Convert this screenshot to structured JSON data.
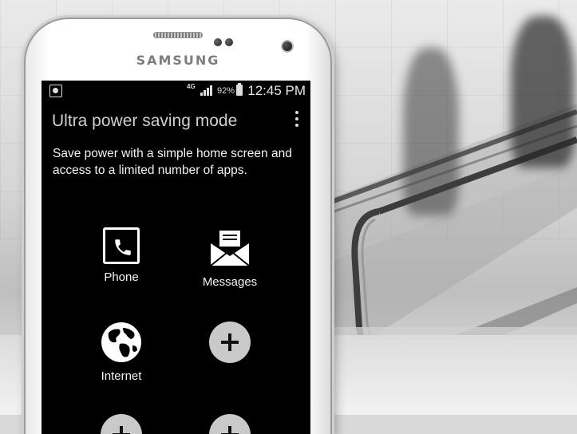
{
  "device": {
    "brand": "SAMSUNG"
  },
  "status_bar": {
    "network": "4G",
    "battery_percent": "92%",
    "time": "12:45 PM",
    "icons": [
      "gallery-notification-icon",
      "signal-icon",
      "battery-icon"
    ]
  },
  "header": {
    "title": "Ultra power saving mode",
    "menu_icon": "overflow-menu-icon"
  },
  "description": "Save power with a simple home screen and access to a limited number of apps.",
  "apps": [
    {
      "label": "Phone",
      "icon": "phone-icon"
    },
    {
      "label": "Messages",
      "icon": "envelope-icon"
    },
    {
      "label": "Internet",
      "icon": "globe-icon"
    },
    {
      "label": "",
      "icon": "add-icon"
    },
    {
      "label": "",
      "icon": "add-icon"
    },
    {
      "label": "",
      "icon": "add-icon"
    }
  ],
  "colors": {
    "screen_bg": "#000000",
    "add_button": "#c9c9c9",
    "title_text": "#cfcfcf"
  }
}
